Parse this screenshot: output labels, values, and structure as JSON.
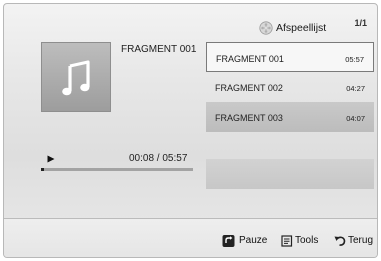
{
  "header": {
    "title": "Afspeellijst",
    "page_counter": "1/1",
    "title_icon": "disc-icon"
  },
  "now_playing": {
    "title": "FRAGMENT 001",
    "art_icon": "music-note-icon",
    "status_icon": "play-icon",
    "time": "00:08 / 05:57",
    "progress": 0.02
  },
  "playlist": [
    {
      "name": "FRAGMENT 001",
      "duration": "05:57",
      "state": "focused"
    },
    {
      "name": "FRAGMENT 002",
      "duration": "04:27",
      "state": "normal"
    },
    {
      "name": "FRAGMENT 003",
      "duration": "04:07",
      "state": "highlighted"
    }
  ],
  "footer": {
    "pause_label": "Pauze",
    "tools_label": "Tools",
    "back_label": "Terug"
  },
  "colors": {
    "text": "#222222",
    "progress_fill": "#222222",
    "progress_track": "#a3a3a3",
    "focus_border": "#7a7a7a"
  }
}
